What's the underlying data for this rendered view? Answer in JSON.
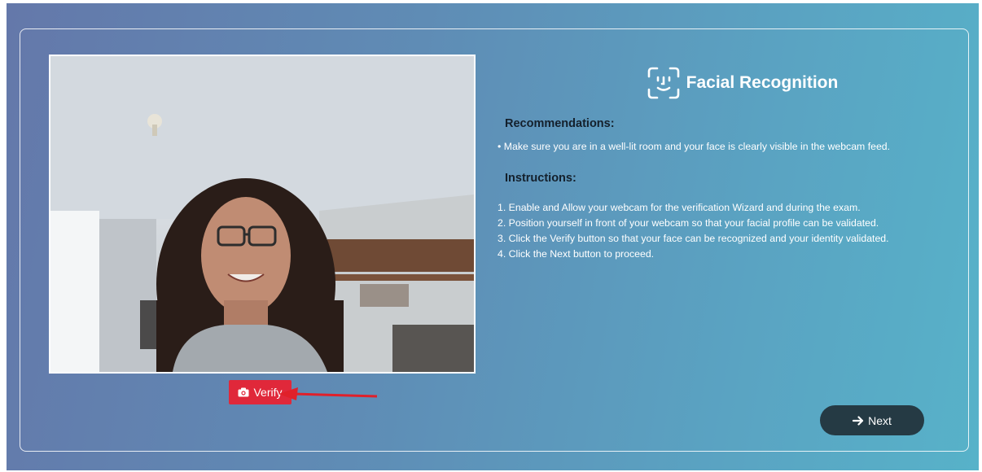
{
  "webcam": {
    "verify_label": "Verify"
  },
  "panel": {
    "title": "Facial Recognition",
    "recommendations_heading": "Recommendations:",
    "recommendation_item": "Make sure you are in a well-lit room and your face is clearly visible in the webcam feed.",
    "instructions_heading": "Instructions:",
    "instructions": [
      "1. Enable and Allow your webcam for the verification Wizard and during the exam.",
      "2. Position yourself in front of your webcam so that your facial profile can be validated.",
      "3. Click the Verify button so that your face can be recognized and your identity validated.",
      "4. Click the Next button to proceed."
    ]
  },
  "footer": {
    "next_label": "Next"
  },
  "colors": {
    "verify_button": "#e0283a",
    "next_button": "#253a44",
    "heading_text": "#14202c",
    "annotation_arrow": "#e0202a"
  },
  "icons": {
    "title_icon": "face-id-icon",
    "verify_icon": "camera-icon",
    "next_icon": "arrow-right-icon",
    "annotation": "red-arrow-annotation"
  }
}
